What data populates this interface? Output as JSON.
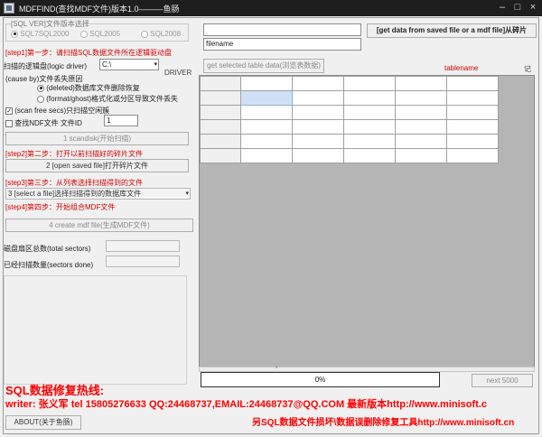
{
  "window": {
    "title": "MDFFIND(查找MDF文件)版本1.0———鱼肠",
    "min_glyph": "–",
    "max_glyph": "□",
    "close_glyph": "×"
  },
  "version_group": {
    "label": "[SQL VER]文件版本选择",
    "options": [
      "SQL7SQL2000",
      "SQL2005",
      "SQL2008"
    ],
    "selected": 0
  },
  "step1": {
    "text": "[step1]第一步：请扫描SQL数据文件所在逻辑驱动盘",
    "drive_label": "扫描的逻辑盘(logic driver)",
    "drive_value": "C:\\",
    "driver_label": "DRIVER",
    "cause_label": "(cause by)文件丢失原因",
    "cause_options": [
      "(deleted)数据库文件删除恢复",
      "(format/ghost)格式化或分区导致文件丢失"
    ],
    "cause_selected": 0,
    "scan_free_label": "(scan free secs)只扫描空闲簇",
    "scan_free_checked": true,
    "find_ndf_label": "查找NDF文件 文件ID",
    "find_ndf_checked": false,
    "file_id_value": "1",
    "scan_button": "1 scandisk(开始扫描)"
  },
  "step2": {
    "text": "[step2]第二步：打开以前扫描好的碎片文件",
    "button": "2 [open saved file]打开碎片文件"
  },
  "step3": {
    "text": "[step3]第三步：从列表选择扫描得到的文件",
    "select_value": "3 [select a file]选择扫描得到的数据库文件"
  },
  "step4": {
    "text": "[step4]第四步：开始组合MDF文件",
    "button": "4 create mdf file(生成MDF文件)"
  },
  "stats": {
    "total_label": "磁盘扇区总数(total sectors)",
    "done_label": "已经扫描数量(sectors done)",
    "total_value": "",
    "done_value": ""
  },
  "right": {
    "top_input_value": "",
    "get_data_button": "[get data from saved file or a mdf file]从碎片",
    "filename_label": "filename",
    "get_selected_button": "get selected table data(浏览表数据)",
    "tablename_label": "tablename",
    "tablename_cut": "记"
  },
  "grid": {
    "rows": 5,
    "cols": 5,
    "selected_row": 0,
    "selected_col": 0
  },
  "progress": {
    "value": 0,
    "text": "0%"
  },
  "next_button": "next 5000",
  "hotline": {
    "title": "SQL数据修复热线:",
    "writer": "writer: 张义军 tel 15805276633 QQ:24468737,EMAIL:24468737@QQ.COM 最新版本http://www.minisoft.c",
    "other": "另SQL数据文件损坏\\数据误删除修复工具http://www.minisoft.cn"
  },
  "about_button": "ABOUT(关于鱼肠)",
  "colors": {
    "accent_red": "#d00000",
    "hotline_red": "#ff0000",
    "title_bar": "#1e1e1e",
    "window_bg": "#f0f0f0",
    "grid_bg": "#b5b5b5",
    "selected_cell": "#cfe0f5"
  }
}
